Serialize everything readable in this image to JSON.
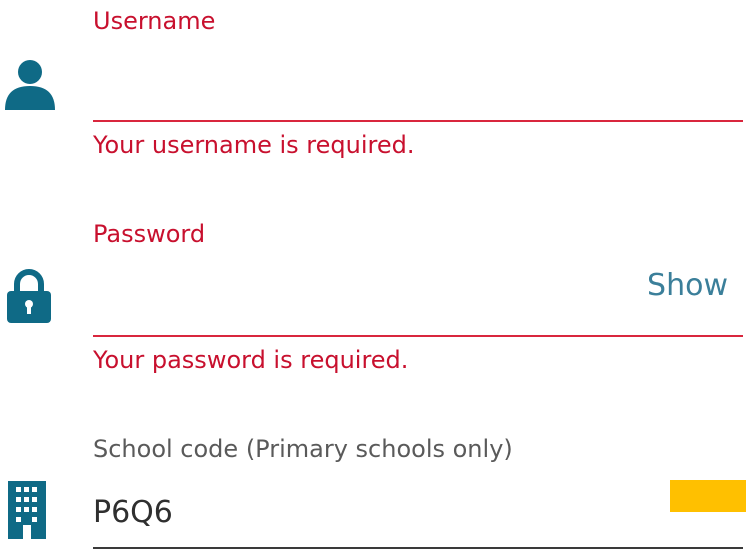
{
  "username": {
    "label": "Username",
    "value": "",
    "error": "Your username is required.",
    "icon": "user-icon"
  },
  "password": {
    "label": "Password",
    "value": "",
    "toggle_label": "Show",
    "error": "Your password is required.",
    "icon": "lock-icon"
  },
  "school_code": {
    "label": "School code (Primary schools only)",
    "value": "P6Q6",
    "icon": "building-icon"
  },
  "colors": {
    "error": "#c8102e",
    "icon": "#0f6a86",
    "accent": "#3b7f9a",
    "highlight": "#ffc000"
  }
}
